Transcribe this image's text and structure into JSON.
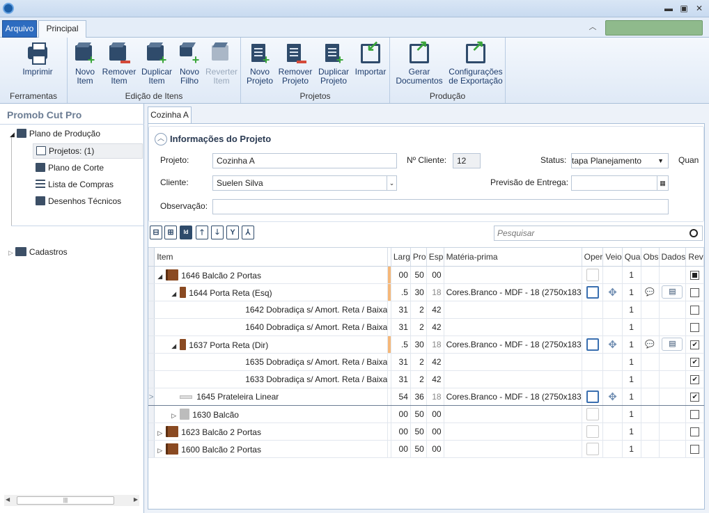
{
  "ribbon_tabs": [
    "Arquivo",
    "Principal"
  ],
  "ribbon": {
    "ferramentas": {
      "label": "Ferramentas",
      "imprimir": "Imprimir"
    },
    "edicao": {
      "label": "Edição de Itens",
      "novo_item": [
        "Novo",
        "Item"
      ],
      "remover_item": [
        "Remover",
        "Item"
      ],
      "duplicar_item": [
        "Duplicar",
        "Item"
      ],
      "novo_filho": [
        "Novo",
        "Filho"
      ],
      "reverter_item": [
        "Reverter",
        "Item"
      ]
    },
    "projetos": {
      "label": "Projetos",
      "novo_projeto": [
        "Novo",
        "Projeto"
      ],
      "remover_projeto": [
        "Remover",
        "Projeto"
      ],
      "duplicar_projeto": [
        "Duplicar",
        "Projeto"
      ],
      "importar": "Importar"
    },
    "producao": {
      "label": "Produção",
      "gerar_documentos": [
        "Gerar",
        "Documentos"
      ],
      "config_exportacao": [
        "Configurações",
        "de Exportação"
      ]
    }
  },
  "left_pane": {
    "title": "Promob Cut Pro",
    "plano_producao": "Plano de Produção",
    "projetos": "Projetos: (1)",
    "plano_corte": "Plano de Corte",
    "lista_compras": "Lista de Compras",
    "desenhos_tecnicos": "Desenhos Técnicos",
    "cadastros": "Cadastros"
  },
  "doc_tab": "Cozinha A",
  "project_info": {
    "title": "Informações do Projeto",
    "projeto_label": "Projeto:",
    "projeto_value": "Cozinha A",
    "ncliente_label": "Nº Cliente:",
    "ncliente_value": "12",
    "status_label": "Status:",
    "status_value": "tapa Planejamento",
    "quan_label": "Quan",
    "cliente_label": "Cliente:",
    "cliente_value": "Suelen Silva",
    "previsao_label": "Previsão de Entrega:",
    "previsao_value": "",
    "observacao_label": "Observação:",
    "observacao_value": ""
  },
  "search": {
    "placeholder": "Pesquisar"
  },
  "grid": {
    "columns": [
      "Item",
      "Larg",
      "Pro",
      "Esp",
      "Matéria-prima",
      "Oper",
      "Veio",
      "Qua",
      "Obs",
      "Dados",
      "Rev"
    ],
    "rows": [
      {
        "indicator": "",
        "level": 0,
        "caret": "◢",
        "icon": "cab",
        "id": "1646",
        "name": "Balcão 2 Portas",
        "orange": true,
        "larg": "00",
        "pro": "50",
        "esp": "00",
        "esp_gray": false,
        "materia": "",
        "oper": "light",
        "veio": false,
        "qua": "1",
        "obs": false,
        "dados": false,
        "rev": "sq"
      },
      {
        "indicator": "",
        "level": 1,
        "caret": "◢",
        "icon": "door",
        "id": "1644",
        "name": "Porta Reta (Esq)",
        "orange": true,
        "larg": ".5",
        "pro": "30",
        "esp": "18",
        "esp_gray": true,
        "materia": "Cores.Branco - MDF - 18 (2750x183",
        "oper": "bold",
        "veio": true,
        "qua": "1",
        "obs": true,
        "dados": true,
        "rev": "off"
      },
      {
        "indicator": "",
        "level": 2,
        "caret": "",
        "icon": "",
        "id": "1642",
        "name": "Dobradiça s/ Amort. Reta / Baixa",
        "orange": false,
        "larg": "31",
        "pro": "2",
        "esp": "42",
        "esp_gray": false,
        "materia": "",
        "oper": "",
        "veio": false,
        "qua": "1",
        "obs": false,
        "dados": false,
        "rev": "off"
      },
      {
        "indicator": "",
        "level": 2,
        "caret": "",
        "icon": "",
        "id": "1640",
        "name": "Dobradiça s/ Amort. Reta / Baixa",
        "orange": false,
        "larg": "31",
        "pro": "2",
        "esp": "42",
        "esp_gray": false,
        "materia": "",
        "oper": "",
        "veio": false,
        "qua": "1",
        "obs": false,
        "dados": false,
        "rev": "off"
      },
      {
        "indicator": "",
        "level": 1,
        "caret": "◢",
        "icon": "door",
        "id": "1637",
        "name": "Porta Reta (Dir)",
        "orange": true,
        "larg": ".5",
        "pro": "30",
        "esp": "18",
        "esp_gray": true,
        "materia": "Cores.Branco - MDF - 18 (2750x183",
        "oper": "bold",
        "veio": true,
        "qua": "1",
        "obs": true,
        "dados": true,
        "rev": "on"
      },
      {
        "indicator": "",
        "level": 2,
        "caret": "",
        "icon": "",
        "id": "1635",
        "name": "Dobradiça s/ Amort. Reta / Baixa",
        "orange": false,
        "larg": "31",
        "pro": "2",
        "esp": "42",
        "esp_gray": false,
        "materia": "",
        "oper": "",
        "veio": false,
        "qua": "1",
        "obs": false,
        "dados": false,
        "rev": "on"
      },
      {
        "indicator": "",
        "level": 2,
        "caret": "",
        "icon": "",
        "id": "1633",
        "name": "Dobradiça s/ Amort. Reta / Baixa",
        "orange": false,
        "larg": "31",
        "pro": "2",
        "esp": "42",
        "esp_gray": false,
        "materia": "",
        "oper": "",
        "veio": false,
        "qua": "1",
        "obs": false,
        "dados": false,
        "rev": "on"
      },
      {
        "indicator": ">",
        "level": 1,
        "caret": "",
        "icon": "shelf",
        "id": "1645",
        "name": "Prateleira Linear",
        "orange": false,
        "larg": "54",
        "pro": "36",
        "esp": "18",
        "esp_gray": true,
        "materia": "Cores.Branco - MDF - 18 (2750x183",
        "oper": "bold",
        "veio": true,
        "qua": "1",
        "obs": false,
        "dados": false,
        "rev": "on",
        "selected": true
      },
      {
        "indicator": "",
        "level": 1,
        "caret": "▷",
        "icon": "gray",
        "id": "1630",
        "name": "Balcão",
        "orange": false,
        "larg": "00",
        "pro": "50",
        "esp": "00",
        "esp_gray": false,
        "materia": "",
        "oper": "light",
        "veio": false,
        "qua": "1",
        "obs": false,
        "dados": false,
        "rev": "off"
      },
      {
        "indicator": "",
        "level": 0,
        "caret": "▷",
        "icon": "cab",
        "id": "1623",
        "name": "Balcão 2 Portas",
        "orange": false,
        "larg": "00",
        "pro": "50",
        "esp": "00",
        "esp_gray": false,
        "materia": "",
        "oper": "light",
        "veio": false,
        "qua": "1",
        "obs": false,
        "dados": false,
        "rev": "off"
      },
      {
        "indicator": "",
        "level": 0,
        "caret": "▷",
        "icon": "cab",
        "id": "1600",
        "name": "Balcão 2 Portas",
        "orange": false,
        "larg": "00",
        "pro": "50",
        "esp": "00",
        "esp_gray": false,
        "materia": "",
        "oper": "light",
        "veio": false,
        "qua": "1",
        "obs": false,
        "dados": false,
        "rev": "off"
      }
    ]
  }
}
